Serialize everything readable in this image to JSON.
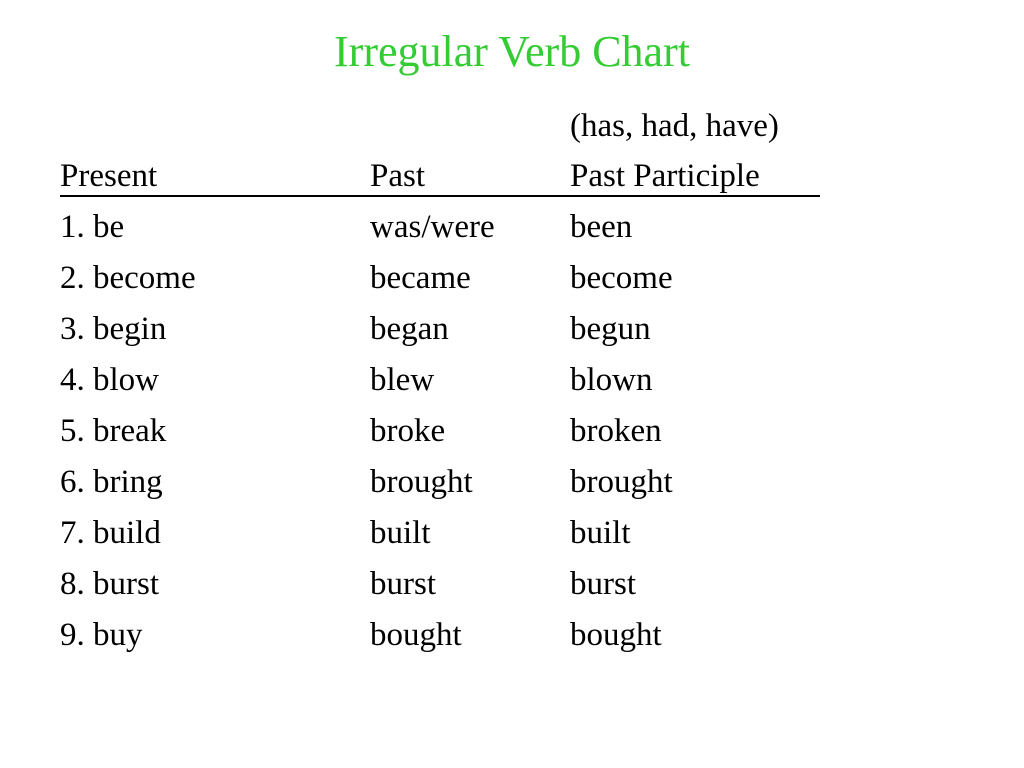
{
  "slide": {
    "title": "Irregular Verb Chart",
    "title_color": "#33cc33",
    "background_color": "#ffffff",
    "text_color": "#000000"
  },
  "table": {
    "auxiliary_note": "(has, had, have)",
    "headers": {
      "present": "Present",
      "past": "Past",
      "past_participle": "Past Participle"
    },
    "rows": [
      {
        "present": "1. be",
        "past": "was/were",
        "past_participle": "been"
      },
      {
        "present": "2. become",
        "past": "became",
        "past_participle": "become"
      },
      {
        "present": "3. begin",
        "past": "began",
        "past_participle": "begun"
      },
      {
        "present": "4. blow",
        "past": "blew",
        "past_participle": "blown"
      },
      {
        "present": "5. break",
        "past": "broke",
        "past_participle": "broken"
      },
      {
        "present": "6. bring",
        "past": "brought",
        "past_participle": "brought"
      },
      {
        "present": "7. build",
        "past": "built",
        "past_participle": "built"
      },
      {
        "present": "8. burst",
        "past": "burst",
        "past_participle": "burst"
      },
      {
        "present": "9. buy",
        "past": "bought",
        "past_participle": "bought"
      }
    ]
  }
}
